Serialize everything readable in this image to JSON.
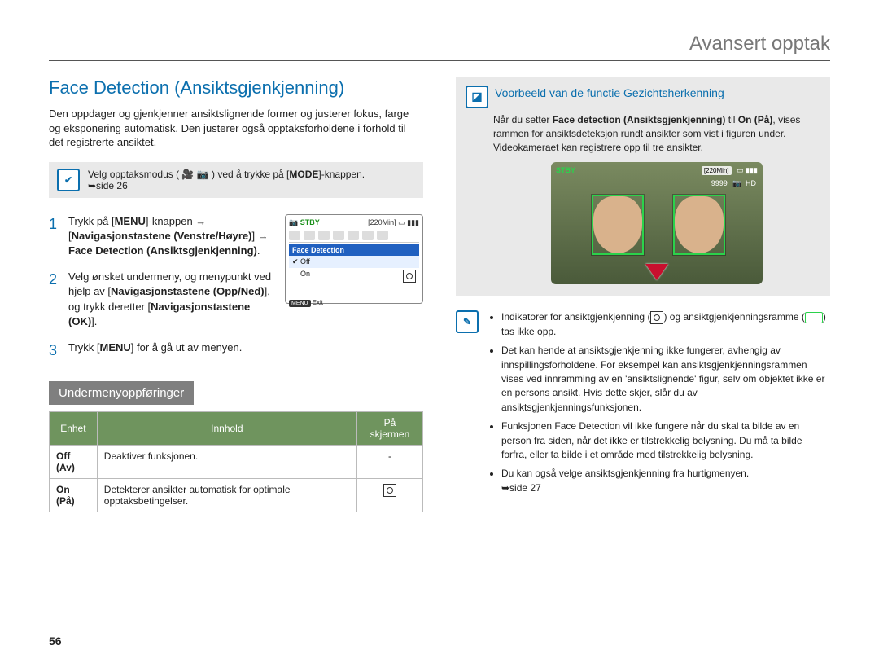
{
  "header": {
    "title": "Avansert opptak"
  },
  "page_number": "56",
  "left": {
    "h2": "Face Detection (Ansiktsgjenkjenning)",
    "intro": "Den oppdager og gjenkjenner ansiktslignende former og justerer fokus, farge og eksponering automatisk. Den justerer også opptaksforholdene i forhold til det registrerte ansiktet.",
    "mode_note_pre": "Velg opptaksmodus (",
    "mode_note_post": ") ved å trykke på [",
    "mode_btn": "MODE",
    "mode_note_end": "]-knappen.",
    "mode_ref": "➥side 26",
    "steps": {
      "s1_a": "Trykk på [",
      "s1_menu": "MENU",
      "s1_b": "]-knappen → [",
      "s1_nav": "Navigasjonstastene (Venstre/Høyre)",
      "s1_c": "] → ",
      "s1_target": "Face Detection (Ansiktsgjenkjenning)",
      "s1_d": ".",
      "s2_a": "Velg ønsket undermeny, og menypunkt ved hjelp av [",
      "s2_nav": "Navigasjonstastene (Opp/Ned)",
      "s2_b": "], og trykk deretter [",
      "s2_ok": "Navigasjonstastene (OK)",
      "s2_c": "].",
      "s3_a": "Trykk [",
      "s3_menu": "MENU",
      "s3_b": "] for å gå ut av menyen."
    },
    "menu_lcd": {
      "stby": "STBY",
      "time": "[220Min]",
      "title": "Face Detection",
      "off": "Off",
      "on": "On",
      "exit_tag": "MENU",
      "exit": "Exit"
    },
    "sub_heading": "Undermenyoppføringer",
    "table": {
      "th1": "Enhet",
      "th2": "Innhold",
      "th3": "På skjermen",
      "rows": [
        {
          "c1": "Off (Av)",
          "c2": "Deaktiver funksjonen.",
          "c3": "-"
        },
        {
          "c1": "On (På)",
          "c2": "Detekterer ansikter automatisk for optimale opptaksbetingelser.",
          "c3_icon": true
        }
      ]
    }
  },
  "right": {
    "ex_title": "Voorbeeld van de functie Gezichtsherkenning",
    "ex_p1_a": "Når du setter ",
    "ex_p1_b": "Face detection (Ansiktsgjenkjenning)",
    "ex_p1_c": " til ",
    "ex_p1_d": "On (På)",
    "ex_p1_e": ", vises rammen for ansiktsdeteksjon rundt ansikter som vist i figuren under.",
    "ex_p2": "Videokameraet kan registrere opp til tre ansikter.",
    "preview": {
      "stby": "STBY",
      "time": "[220Min]",
      "count": "9999",
      "hd": "HD"
    },
    "notes": {
      "n1_a": "Indikatorer for ansiktgjenkjenning (",
      "n1_b": ") og ansiktgjenkjenningsramme (",
      "n1_c": ") tas ikke opp.",
      "n2": "Det kan hende at ansiktsgjenkjenning ikke fungerer, avhengig av innspillingsforholdene. For eksempel kan ansiktsgjenkjenningsrammen vises ved innramming av en 'ansiktslignende' figur, selv om objektet ikke er en persons ansikt. Hvis dette skjer, slår du av ansiktsgjenkjenningsfunksjonen.",
      "n3": "Funksjonen Face Detection vil ikke fungere når du skal ta bilde av en person fra siden, når det ikke er tilstrekkelig belysning. Du må ta bilde forfra, eller ta bilde i et område med tilstrekkelig belysning.",
      "n4": "Du kan også velge ansiktsgjenkjenning fra hurtigmenyen.",
      "n4_ref": "➥side 27"
    }
  }
}
